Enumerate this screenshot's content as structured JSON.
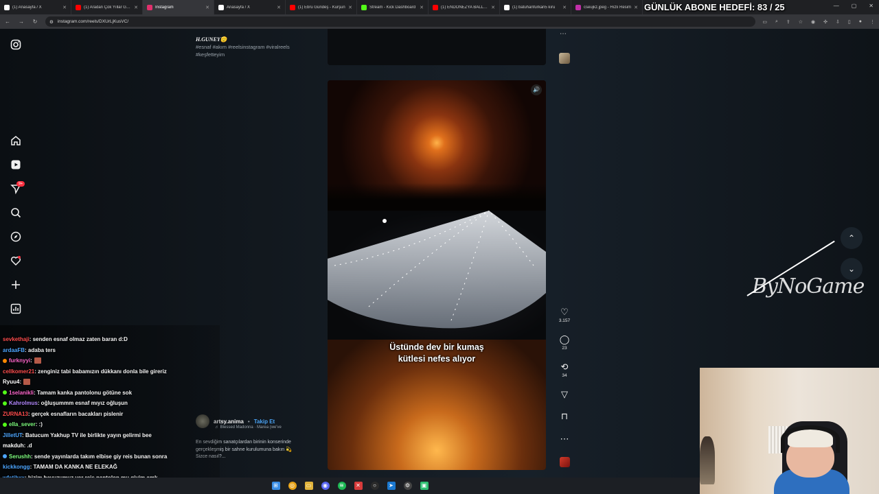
{
  "browser": {
    "tabs": [
      {
        "title": "(1) Anasayfa / X",
        "icon": "x-logo-icon",
        "color": "#ffffff"
      },
      {
        "title": "(1) Aradan Çok Yıllar Geçti",
        "icon": "youtube-icon",
        "color": "#ff0000"
      },
      {
        "title": "Instagram",
        "icon": "instagram-icon",
        "color": "#e1306c",
        "active": true
      },
      {
        "title": "Anasayfa / X",
        "icon": "x-logo-icon",
        "color": "#ffffff"
      },
      {
        "title": "(1) Ebru Gündeş - Kurşun",
        "icon": "youtube-icon",
        "color": "#ff0000"
      },
      {
        "title": "Stream - Kick Dashboard",
        "icon": "kick-icon",
        "color": "#53fc18"
      },
      {
        "title": "(1) ENDONEZYA BALLBU",
        "icon": "youtube-icon",
        "color": "#ff0000"
      },
      {
        "title": "(1) batuhanfurkan5 kıru",
        "icon": "x-logo-icon",
        "color": "#ffffff"
      },
      {
        "title": "cseujkz.jpeg - Hızlı Resim",
        "icon": "image-icon",
        "color": "#c12fa8"
      }
    ],
    "url": "instagram.com/reels/DXUrLjKusVC/"
  },
  "stream_overlay": {
    "sub_goal": "GÜNLÜK ABONE HEDEFİ: 83 / 25",
    "watermark": "ByNoGame"
  },
  "previous_post": {
    "author": "H.GUNEY🫡",
    "caption": "#esnaf #akım #reelsinstagram #viralreels #keşfetteyim"
  },
  "reel": {
    "subtitle_line1": "Üstünde dev bir kumaş",
    "subtitle_line2": "kütlesi nefes alıyor",
    "author": "artsy.anima",
    "separator": "•",
    "follow_label": "Takip Et",
    "music": "♬ Blessed Madonna · Marea (we've",
    "caption": "En sevdiğim sanatçılardan birinin konserinde gerçekleşmiş bir sahne kurulumuna bakın 💫 Sizce nasıl?...",
    "likes": "3.157",
    "comments": "23",
    "reposts": "34"
  },
  "sidebar": {
    "notification_count": "9+"
  },
  "chat": [
    {
      "user": "sevkethaji",
      "color": "#ff4d4d",
      "message": ": senden esnaf olmaz zaten baran d:D"
    },
    {
      "user": "ardaaFB",
      "color": "#4da6ff",
      "message": ": adaba ters"
    },
    {
      "user": "furknyyi",
      "color": "#ff66cc",
      "message": ":",
      "emote": true,
      "badge": "#ff8800"
    },
    {
      "user": "cellkomer21",
      "color": "#ff4d4d",
      "message": ": zenginiz tabi babamızın dükkanı donla bile gireriz"
    },
    {
      "user": "Ryuu4",
      "color": "#ffffff",
      "message": ":",
      "emote": true
    },
    {
      "user": "1selanikli",
      "color": "#ff66cc",
      "message": ": Tamam kanka pantolonu götüne sok",
      "badge": "#53fc18"
    },
    {
      "user": "Kahrolmus",
      "color": "#b388ff",
      "message": ": oğluşummm esnaf mıyız oğluşun",
      "badge": "#53fc18"
    },
    {
      "user": "ZURNA13",
      "color": "#ff4d4d",
      "message": ": gerçek esnafların bacakları pislenir"
    },
    {
      "user": "ella_sever",
      "color": "#7fff7f",
      "message": ": :)",
      "badge": "#53fc18"
    },
    {
      "user": "JilletUT",
      "color": "#4da6ff",
      "message": ": Batucum Yakhup TV ile birlikte yayın gelirmi bee"
    },
    {
      "user": "makduh",
      "color": "#ffffff",
      "message": ": .d"
    },
    {
      "user": "Serushh",
      "color": "#7fff7f",
      "message": ": sende yayınlarda takım elbise giy reis bunan sonra",
      "badge": "#4da6ff"
    },
    {
      "user": "kickkongg",
      "color": "#4da6ff",
      "message": ": TAMAM DA KANKA NE ELEKAĞ"
    },
    {
      "user": "wfatihxx",
      "color": "#4da6ff",
      "message": ": bizim havuzumuz var reis pantolon mu giyim amk"
    }
  ]
}
